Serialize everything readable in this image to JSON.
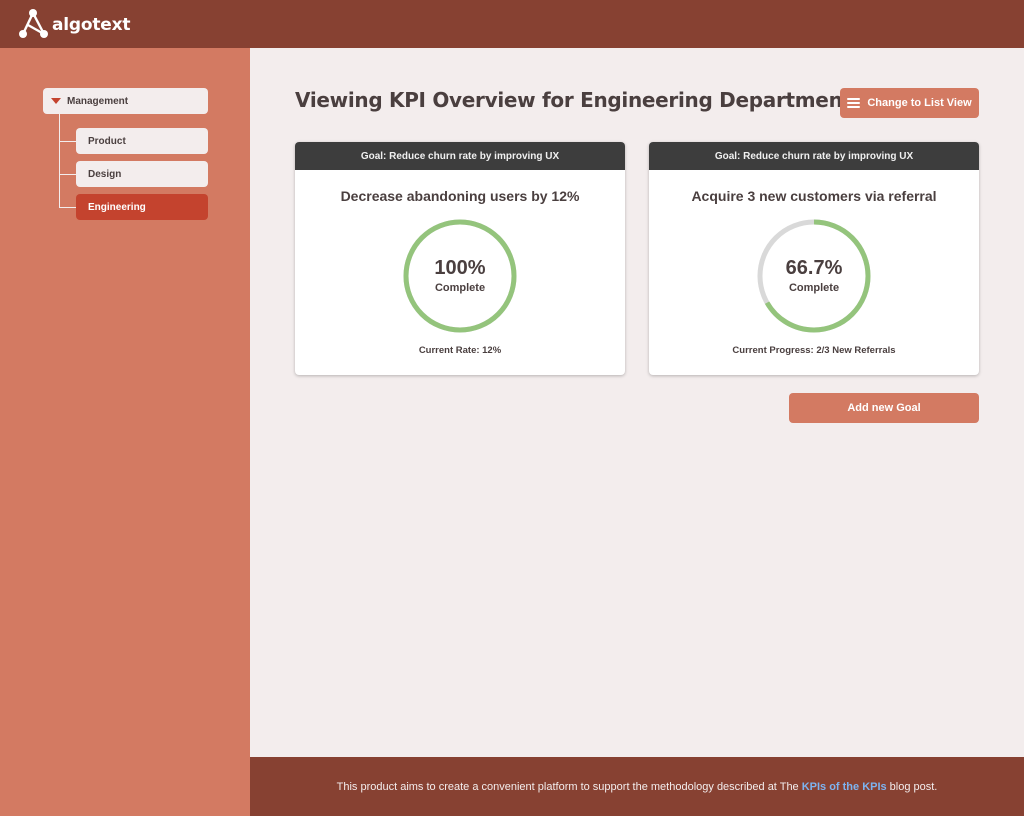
{
  "app": {
    "logo_text": "algotext"
  },
  "sidebar": {
    "root": {
      "label": "Management"
    },
    "items": [
      {
        "label": "Product",
        "active": false
      },
      {
        "label": "Design",
        "active": false
      },
      {
        "label": "Engineering",
        "active": true
      }
    ]
  },
  "main": {
    "title": "Viewing KPI Overview for Engineering Department",
    "view_button_label": "Change to List View",
    "add_goal_label": "Add new Goal",
    "cards": [
      {
        "goal": "Goal: Reduce churn rate by improving UX",
        "title": "Decrease abandoning users by 12%",
        "progress": 1.0,
        "percent_text": "100%",
        "status_text": "Complete",
        "footer": "Current Rate: 12%"
      },
      {
        "goal": "Goal: Reduce churn rate by improving UX",
        "title": "Acquire 3 new customers via referral",
        "progress": 0.667,
        "percent_text": "66.7%",
        "status_text": "Complete",
        "footer": "Current Progress: 2/3 New Referrals"
      }
    ]
  },
  "footer": {
    "text_before": "This product aims to create a convenient platform to support the methodology described at The",
    "link_text": "KPIs of the KPIs",
    "text_after": "blog post."
  },
  "colors": {
    "topbar": "#874132",
    "sidebar": "#d37a62",
    "accent_active": "#c4432e",
    "progress_ring": "#94c47c",
    "ring_track": "#d9d9d9"
  }
}
